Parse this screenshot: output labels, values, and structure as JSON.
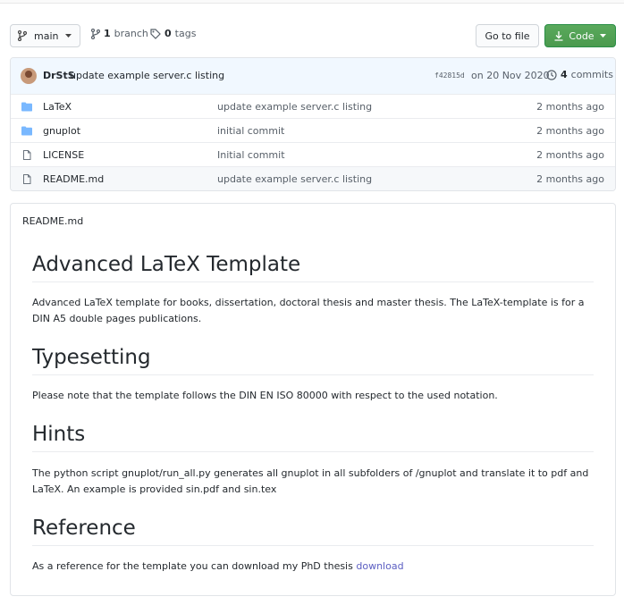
{
  "toolbar": {
    "branch_label": "main",
    "branches_count": "1",
    "branches_text": "branch",
    "tags_count": "0",
    "tags_text": "tags",
    "goto_label": "Go to file",
    "code_label": "Code"
  },
  "commit": {
    "author": "DrStS",
    "message": "update example server.c listing",
    "sha": "f42815d",
    "date": "on 20 Nov 2020",
    "commits_count": "4",
    "commits_text": "commits"
  },
  "files": [
    {
      "name": "LaTeX",
      "type": "folder",
      "message": "update example server.c listing",
      "age": "2 months ago"
    },
    {
      "name": "gnuplot",
      "type": "folder",
      "message": "initial commit",
      "age": "2 months ago"
    },
    {
      "name": "LICENSE",
      "type": "file",
      "message": "Initial commit",
      "age": "2 months ago"
    },
    {
      "name": "README.md",
      "type": "file",
      "message": "update example server.c listing",
      "age": "2 months ago"
    }
  ],
  "readme": {
    "filename": "README.md",
    "h1_title": "Advanced LaTeX Template",
    "intro": "Advanced LaTeX template for books, dissertation, doctoral thesis and master thesis. The LaTeX-template is for a DIN A5 double pages publications.",
    "h_typesetting": "Typesetting",
    "typesetting_text": "Please note that the template follows the DIN EN ISO 80000 with respect to the used notation.",
    "h_hints": "Hints",
    "hints_text": "The python script gnuplot/run_all.py generates all gnuplot in all subfolders of /gnuplot and translate it to pdf and LaTeX. An example is provided sin.pdf and sin.tex",
    "h_reference": "Reference",
    "reference_text": "As a reference for the template you can download my PhD thesis ",
    "reference_link": "download"
  },
  "colors": {
    "accent_green": "#4b9a4e",
    "folder_blue": "#79b8ff",
    "link": "#5b5ec2"
  }
}
